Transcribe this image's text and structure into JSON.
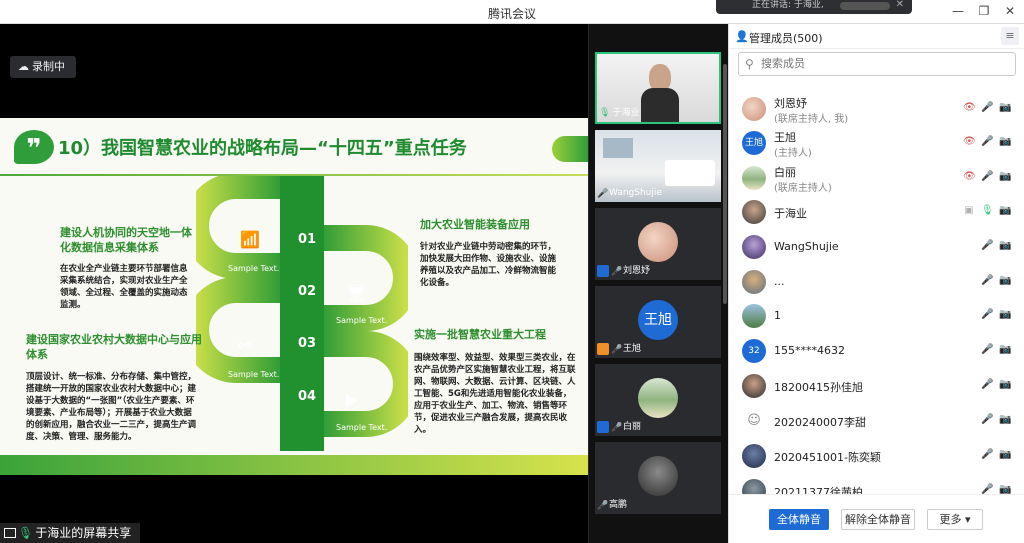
{
  "window": {
    "title": "腾讯会议"
  },
  "notification": {
    "text": "正在讲话: 于海业,"
  },
  "recording": {
    "label": "录制中"
  },
  "screen_share": {
    "sharer_label": "于海业的屏幕共享"
  },
  "slide": {
    "title": "10）我国智慧农业的战略布局—“十四五”重点任务",
    "steps": [
      {
        "num": "01",
        "sample": "Sample Text."
      },
      {
        "num": "02",
        "sample": "Sample Text."
      },
      {
        "num": "03",
        "sample": "Sample Text."
      },
      {
        "num": "04",
        "sample": "Sample Text."
      }
    ],
    "blocks": [
      {
        "heading": "建设人机协同的天空地一体化数据信息采集体系",
        "body": "在农业全产业链主要环节部署信息采集系统结合，实现对农业生产全领域、全过程、全覆盖的实施动态监测。"
      },
      {
        "heading": "加大农业智能装备应用",
        "body": "针对农业产业链中劳动密集的环节，加快发展大田作物、设施农业、设施养殖以及农产品加工、冷鲜物流智能化设备。"
      },
      {
        "heading": "建设国家农业农村大数据中心与应用体系",
        "body": "顶层设计、统一标准、分布存储、集中管控，搭建统一开放的国家农业农村大数据中心；建设基于大数据的“一张图”（农业生产要素、环境要素、产业布局等）；开展基于农业大数据的创新应用，融合农业一二三产，提高生产调度、决策、管理、服务能力。"
      },
      {
        "heading": "实施一批智慧农业重大工程",
        "body": "围绕效率型、效益型、效果型三类农业，在农产品优势产区实施智慧农业工程，将互联网、物联网、大数据、云计算、区块链、人工智能、5G和先进适用智能化农业装备，应用于农业生产、加工、物流、销售等环节，促进农业三产融合发展，提高农民收入。"
      }
    ]
  },
  "video_tiles": [
    {
      "name": "于海业"
    },
    {
      "name": "WangShujie"
    },
    {
      "name": "刘恩妤"
    },
    {
      "name": "王旭",
      "avatar_text": "王旭"
    },
    {
      "name": "白丽"
    },
    {
      "name": "高鹏"
    }
  ],
  "members_panel": {
    "header": "管理成员(500)",
    "search_placeholder": "搜索成员",
    "members": [
      {
        "name": "刘恩妤",
        "role": "(联席主持人, 我)"
      },
      {
        "name": "王旭",
        "role": "(主持人)",
        "avatar_text": "王旭"
      },
      {
        "name": "白丽",
        "role": "(联席主持人)"
      },
      {
        "name": "于海业"
      },
      {
        "name": "WangShujie"
      },
      {
        "name": "..."
      },
      {
        "name": "1"
      },
      {
        "name": "155****4632",
        "avatar_text": "32"
      },
      {
        "name": "18200415孙佳旭"
      },
      {
        "name": "2020240007李甜"
      },
      {
        "name": "2020451001-陈奕颖"
      },
      {
        "name": "20211377徐茜柏"
      }
    ],
    "footer": {
      "mute_all": "全体静音",
      "unmute_all": "解除全体静音",
      "more": "更多 ▾"
    }
  }
}
